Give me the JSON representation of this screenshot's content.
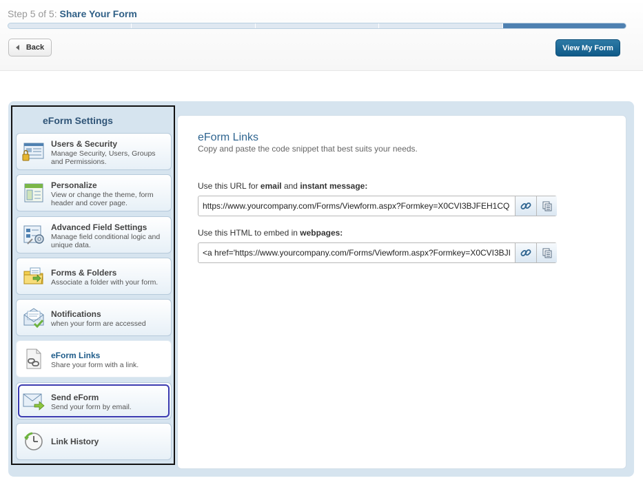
{
  "header": {
    "step_prefix": "Step 5 of 5:",
    "step_name": "Share Your Form",
    "progress": {
      "total_steps": 5,
      "current_step": 5
    },
    "back_label": "Back",
    "view_form_label": "View My Form"
  },
  "sidebar": {
    "title": "eForm Settings",
    "items": [
      {
        "title": "Users & Security",
        "desc": "Manage Security, Users, Groups and Permissions.",
        "icon": "users-security-icon"
      },
      {
        "title": "Personalize",
        "desc": "View or change the theme, form header and cover page.",
        "icon": "personalize-icon"
      },
      {
        "title": "Advanced Field Settings",
        "desc": "Manage field conditional logic and unique data.",
        "icon": "advanced-field-settings-icon"
      },
      {
        "title": "Forms & Folders",
        "desc": "Associate a folder with your form.",
        "icon": "folder-icon"
      },
      {
        "title": "Notifications",
        "desc": "when your form are accessed",
        "icon": "notification-envelope-icon"
      },
      {
        "title": "eForm Links",
        "desc": "Share your form with a link.",
        "icon": "link-document-icon"
      },
      {
        "title": "Send eForm",
        "desc": "Send your form by email.",
        "icon": "send-email-icon"
      },
      {
        "title": "Link History",
        "desc": "",
        "icon": "clock-history-icon"
      }
    ]
  },
  "panel": {
    "title": "eForm Links",
    "subtitle": "Copy and paste the code snippet that best suits your needs.",
    "url_label": {
      "a": "Use this URL for ",
      "b": "email",
      "c": " and ",
      "d": "instant message:"
    },
    "url_value": "https://www.yourcompany.com/Forms/Viewform.aspx?Formkey=X0CVI3BJFEH1CQ",
    "html_label": {
      "a": "Use this HTML to embed in ",
      "b": "webpages:"
    },
    "html_value": "<a href='https://www.yourcompany.com/Forms/Viewform.aspx?Formkey=X0CVI3BJI"
  },
  "colors": {
    "accent": "#2f6590",
    "progress_done": "#4f81b1",
    "sidebar_bg": "#d6e4ef",
    "primary_button": "#0f5a88"
  }
}
